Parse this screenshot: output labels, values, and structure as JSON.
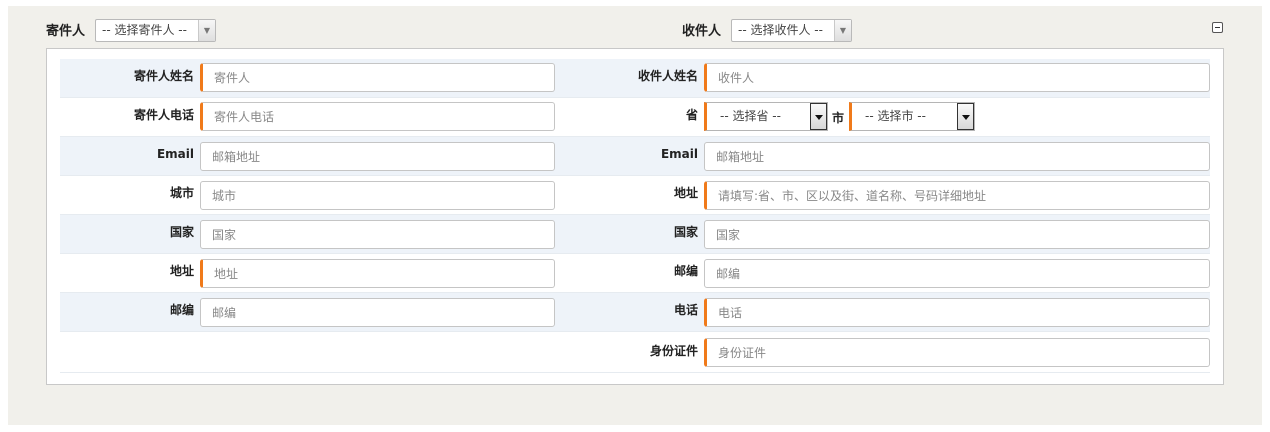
{
  "header": {
    "sender_label": "寄件人",
    "sender_select": "-- 选择寄件人 --",
    "receiver_label": "收件人",
    "receiver_select": "-- 选择收件人 --"
  },
  "sender": {
    "name_label": "寄件人姓名",
    "name_placeholder": "寄件人",
    "phone_label": "寄件人电话",
    "phone_placeholder": "寄件人电话",
    "email_label": "Email",
    "email_placeholder": "邮箱地址",
    "city_label": "城市",
    "city_placeholder": "城市",
    "country_label": "国家",
    "country_placeholder": "国家",
    "address_label": "地址",
    "address_placeholder": "地址",
    "zip_label": "邮编",
    "zip_placeholder": "邮编"
  },
  "receiver": {
    "name_label": "收件人姓名",
    "name_placeholder": "收件人",
    "province_label": "省",
    "province_select": "-- 选择省 --",
    "city_label": "市",
    "city_select": "-- 选择市 --",
    "email_label": "Email",
    "email_placeholder": "邮箱地址",
    "address_label": "地址",
    "address_placeholder": "请填写:省、市、区以及街、道名称、号码详细地址",
    "country_label": "国家",
    "country_placeholder": "国家",
    "zip_label": "邮编",
    "zip_placeholder": "邮编",
    "phone_label": "电话",
    "phone_placeholder": "电话",
    "id_label": "身份证件",
    "id_placeholder": "身份证件"
  },
  "colors": {
    "required_accent": "#f07a1a",
    "row_alt": "#eef3f9",
    "outer_bg": "#f1f0eb"
  },
  "icons": {
    "collapse": "minus-square-icon"
  }
}
